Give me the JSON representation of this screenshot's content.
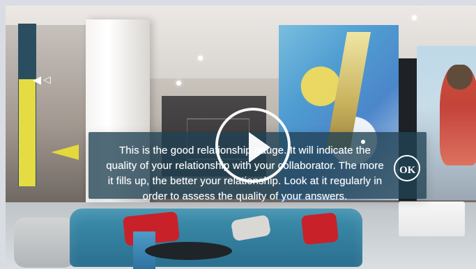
{
  "dialog": {
    "message": "This is the good relationship gauge. It will indicate the quality of your relationship with your collaborator. The more it fills up, the better your relationship. Look at it regularly in order to assess the quality of your answers.",
    "ok_label": "OK"
  },
  "gauge": {
    "level": 0.66
  },
  "icons": {
    "play": "play-icon",
    "pointer": "pointer-icon"
  },
  "colors": {
    "panel": "#214254",
    "gauge_track": "#2b4d60",
    "gauge_fill": "#e4dc42",
    "arrow": "#e5d83d",
    "text": "#ffffff"
  }
}
